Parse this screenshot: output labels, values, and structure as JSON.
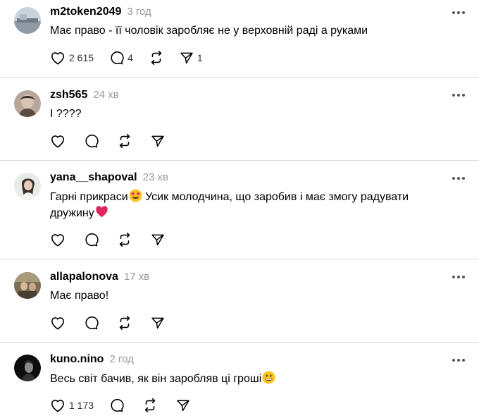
{
  "comments": [
    {
      "username": "m2token2049",
      "time": "3 год",
      "text": "Має право - її чоловік заробляє не у верховній раді а руками",
      "likes": "2 615",
      "replies": "4",
      "reposts": "",
      "shares": "1"
    },
    {
      "username": "zsh565",
      "time": "24 хв",
      "text": "І ????",
      "likes": "",
      "replies": "",
      "reposts": "",
      "shares": ""
    },
    {
      "username": "yana__shapoval",
      "time": "23 хв",
      "text": "Гарні прикраси",
      "text_emoji": "smiling-face-with-heart-eyes",
      "text_2": " Усик молодчина, що заробив і має змогу радувати дружину",
      "text_emoji_2": "red-heart",
      "likes": "",
      "replies": "",
      "reposts": "",
      "shares": ""
    },
    {
      "username": "allapalonova",
      "time": "17 хв",
      "text": "Має право!",
      "likes": "",
      "replies": "",
      "reposts": "",
      "shares": ""
    },
    {
      "username": "kuno.nino",
      "time": "2 год",
      "text": "Весь світ бачив, як він заробляв ці гроші",
      "text_emoji": "grinning-face",
      "likes": "1 173",
      "replies": "",
      "reposts": "",
      "shares": ""
    }
  ],
  "icons": {
    "like": "heart-icon",
    "reply": "comment-bubble-icon",
    "repost": "repost-arrows-icon",
    "share": "send-icon",
    "more": "more-options-icon"
  },
  "colors": {
    "text": "#000000",
    "secondary": "#999999",
    "divider": "#d9d9d9",
    "heart_emoji": "#e0245e",
    "emoji_face": "#f7c325"
  }
}
